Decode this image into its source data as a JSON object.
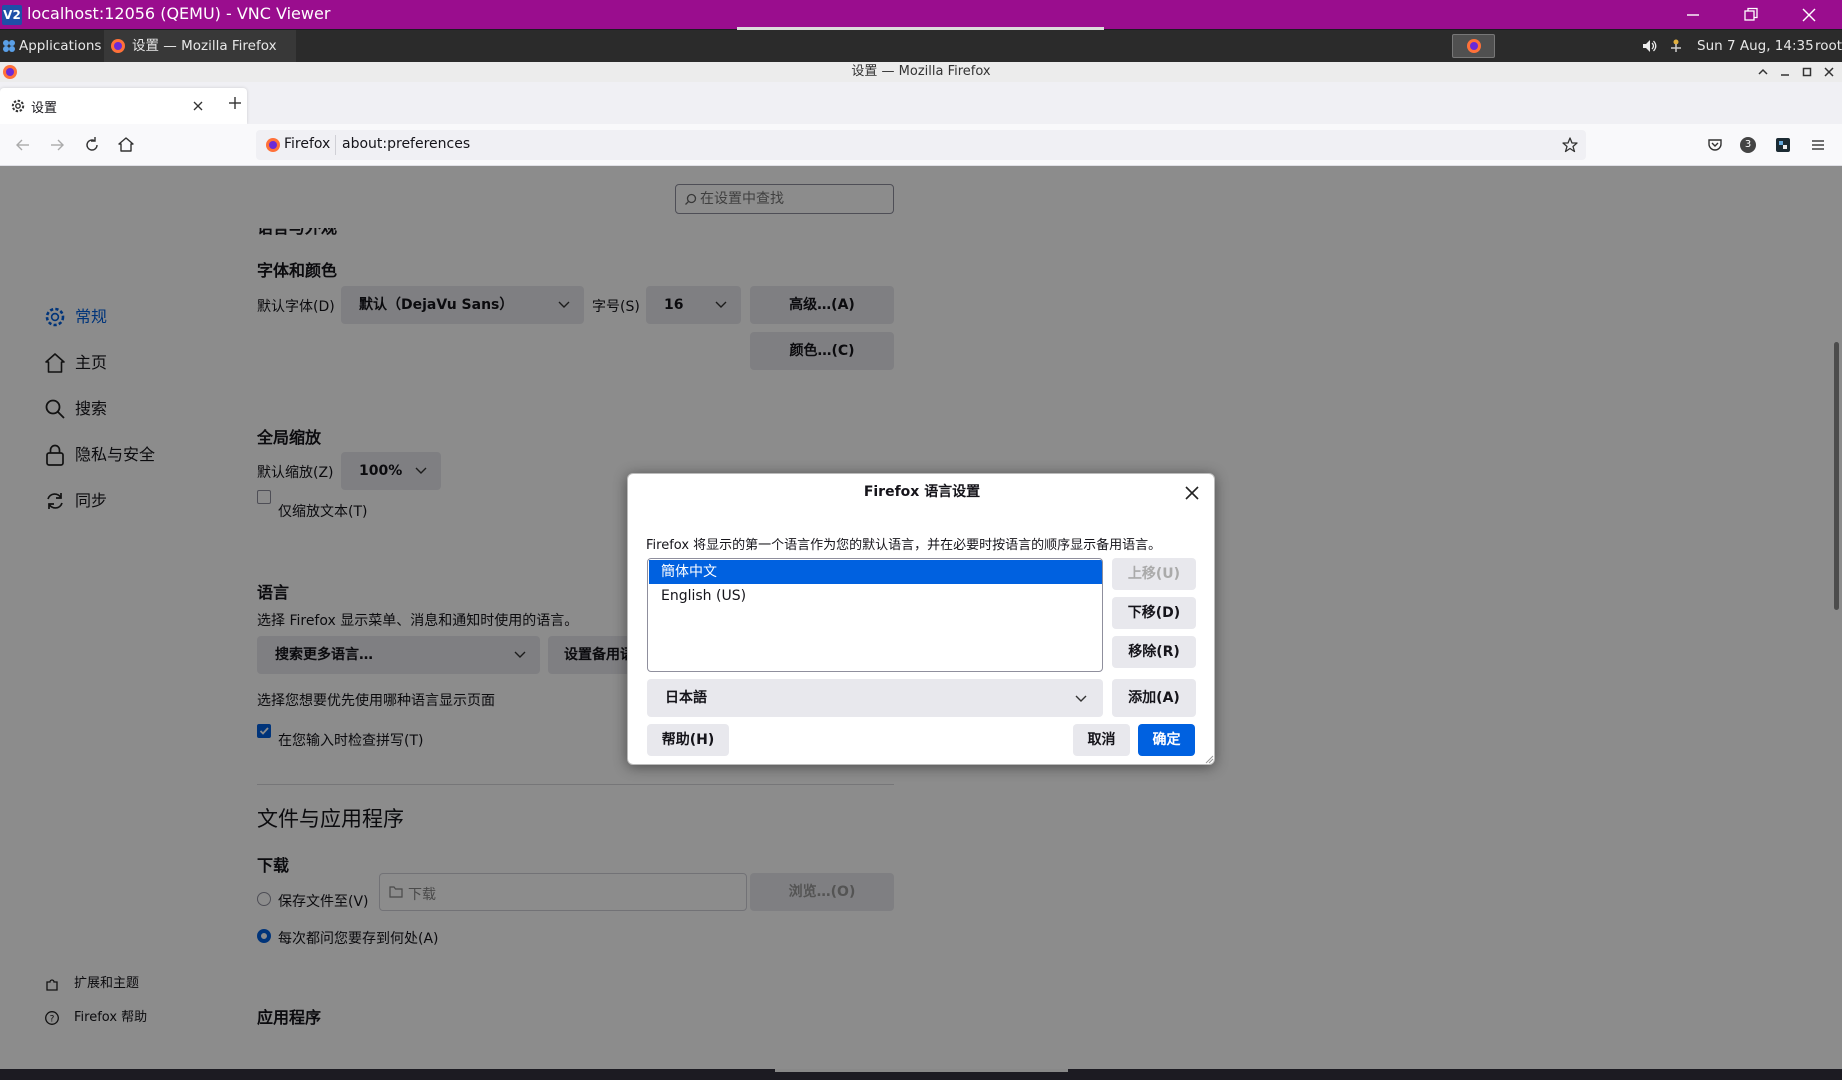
{
  "vnc": {
    "logo": "V2",
    "title": "localhost:12056 (QEMU) - VNC Viewer"
  },
  "panel": {
    "applications": "Applications",
    "task_title": "设置 — Mozilla Firefox",
    "clock": "Sun  7 Aug, 14:35",
    "user": "root"
  },
  "firefox": {
    "window_title": "设置 — Mozilla Firefox",
    "tab_title": "设置",
    "url_identity": "Firefox",
    "url": "about:preferences",
    "account_badge": "3"
  },
  "search": {
    "placeholder": "在设置中查找"
  },
  "sidebar": {
    "items": [
      {
        "label": "常规",
        "icon": "gear-icon"
      },
      {
        "label": "主页",
        "icon": "home-icon"
      },
      {
        "label": "搜索",
        "icon": "search-icon"
      },
      {
        "label": "隐私与安全",
        "icon": "lock-icon"
      },
      {
        "label": "同步",
        "icon": "sync-icon"
      }
    ],
    "footer": [
      {
        "label": "扩展和主题",
        "icon": "puzzle-icon"
      },
      {
        "label": "Firefox 帮助",
        "icon": "help-icon"
      }
    ]
  },
  "fonts": {
    "cut_heading": "语言与外观",
    "heading": "字体和颜色",
    "default_font_label": "默认字体(D)",
    "default_font_value": "默认（DejaVu Sans）",
    "size_label": "字号(S)",
    "size_value": "16",
    "advanced_button": "高级…(A)",
    "colors_button": "颜色…(C)"
  },
  "zoom": {
    "heading": "全局缩放",
    "default_zoom_label": "默认缩放(Z)",
    "default_zoom_value": "100%",
    "text_only_label": "仅缩放文本(T)"
  },
  "language": {
    "heading": "语言",
    "description": "选择 Firefox 显示菜单、消息和通知时使用的语言。",
    "search_more": "搜索更多语言…",
    "set_alternatives": "设置备用语言",
    "page_lang_label": "选择您想要优先使用哪种语言显示页面",
    "spellcheck_label": "在您输入时检查拼写(T)"
  },
  "files": {
    "heading": "文件与应用程序",
    "downloads_heading": "下载",
    "save_to_label": "保存文件至(V)",
    "save_to_path": "下载",
    "browse_button": "浏览…(O)",
    "always_ask_label": "每次都问您要存到何处(A)",
    "apps_heading": "应用程序"
  },
  "dialog": {
    "title": "Firefox 语言设置",
    "description": "Firefox 将显示的第一个语言作为您的默认语言，并在必要时按语言的顺序显示备用语言。",
    "languages": [
      "簡体中文",
      "English (US)"
    ],
    "selected_language": "簡体中文",
    "move_up": "上移(U)",
    "move_down": "下移(D)",
    "remove": "移除(R)",
    "add_select_value": "日本語",
    "add": "添加(A)",
    "help": "帮助(H)",
    "cancel": "取消",
    "ok": "确定"
  },
  "colors": {
    "vnc_bar": "#9a0d8e",
    "accent": "#0060df",
    "selection": "#0061e0"
  }
}
